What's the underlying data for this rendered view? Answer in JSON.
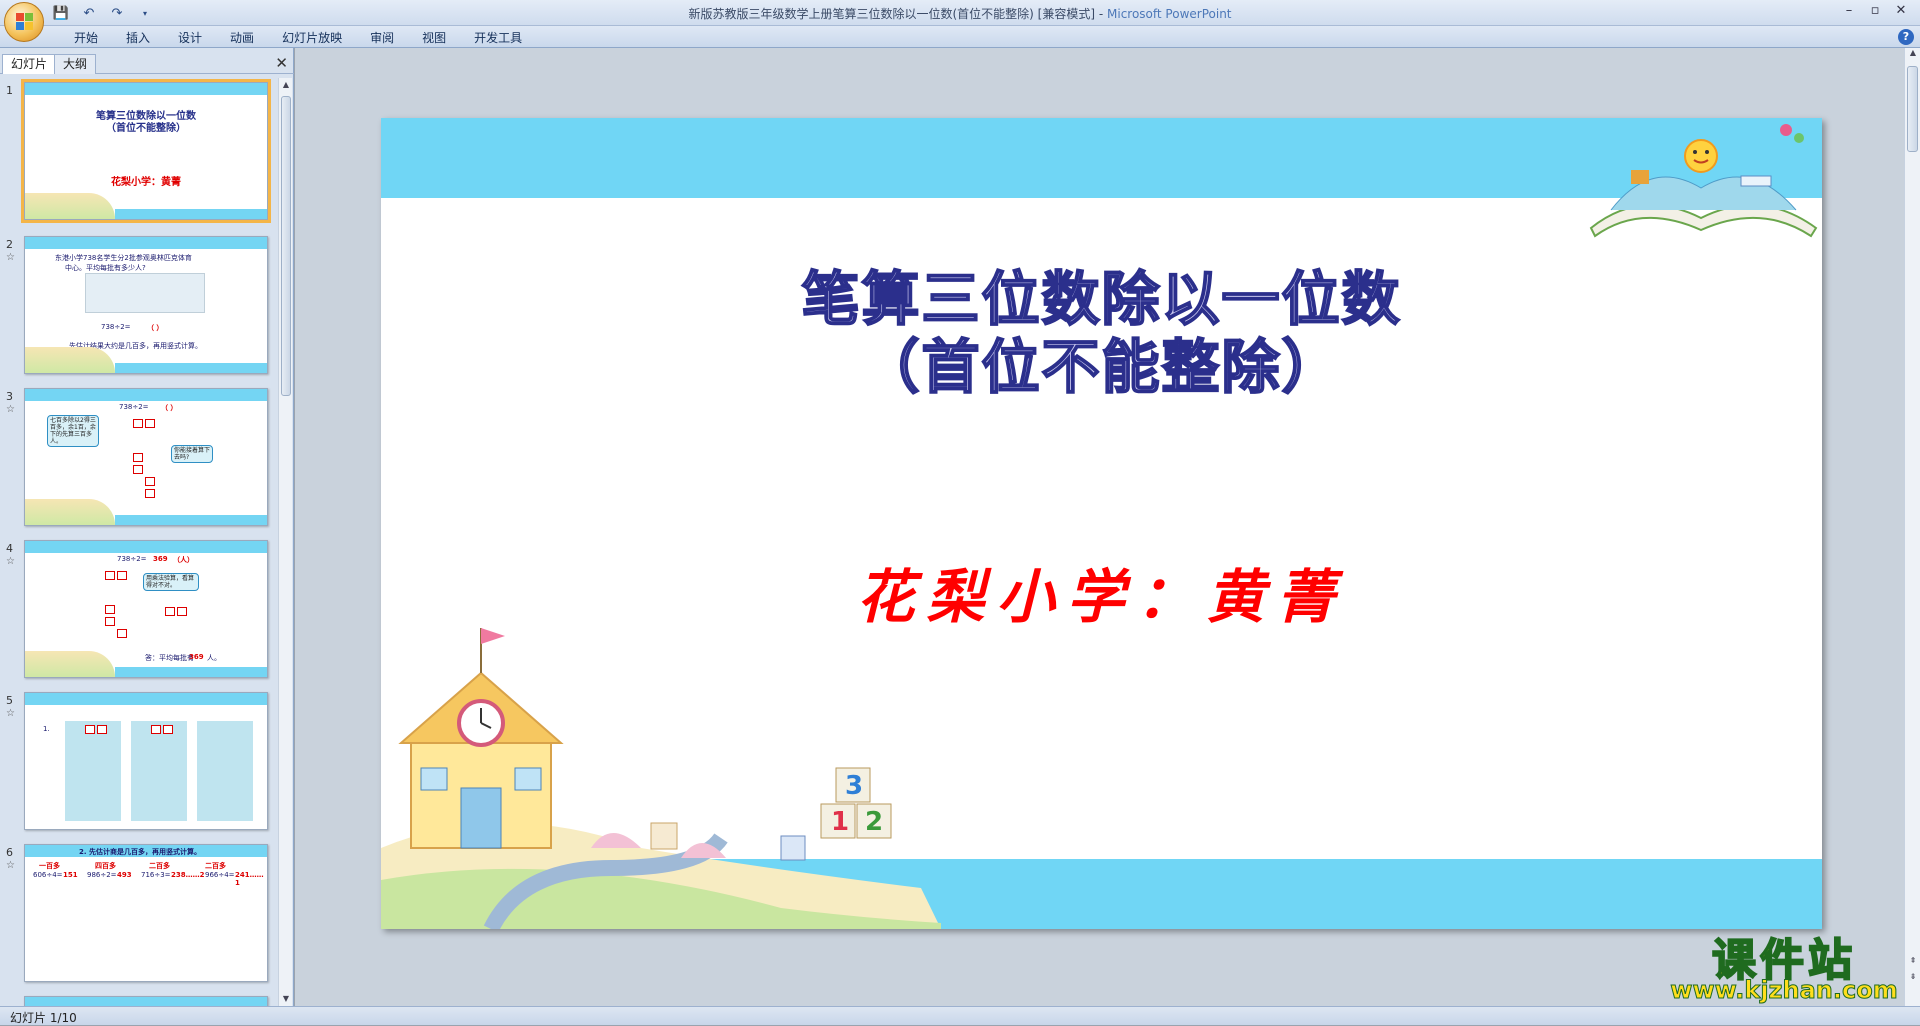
{
  "window": {
    "title": "新版苏教版三年级数学上册笔算三位数除以一位数(首位不能整除) [兼容模式] - ",
    "app_name": "Microsoft PowerPoint"
  },
  "ribbon": {
    "tabs": [
      "开始",
      "插入",
      "设计",
      "动画",
      "幻灯片放映",
      "审阅",
      "视图",
      "开发工具"
    ]
  },
  "pane": {
    "tabs": [
      "幻灯片",
      "大纲"
    ],
    "close": "✕"
  },
  "thumbnails": [
    {
      "num": "1",
      "title_line1": "笔算三位数除以一位数",
      "title_line2": "（首位不能整除）",
      "author": "花梨小学：黄菁"
    },
    {
      "num": "2",
      "text1": "东港小学738名学生分2批参观奥林匹克体育",
      "text2": "中心。平均每批有多少人?",
      "text3": "738÷2=",
      "text4": "（    ）",
      "text5": "先估计结果大约是几百多，再用竖式计算。"
    },
    {
      "num": "3",
      "text1": "738÷2=",
      "text2": "（    ）",
      "bubble1": "七百多除以2得三百多，余1百，余下的先算三百多人。",
      "bubble2": "你能接着算下去吗?"
    },
    {
      "num": "4",
      "text1": "738÷2=",
      "answer": "369",
      "unit": "（人）",
      "bubble": "用乘法验算，看算得对不对。",
      "answer_text": "答：平均每批有",
      "answer_val": "369",
      "answer_unit": "人。"
    },
    {
      "num": "5",
      "label": "1."
    },
    {
      "num": "6",
      "heading": "2. 先估计商是几百多，再用竖式计算。",
      "eq1": "606÷4=",
      "r1": "151",
      "eq2": "986÷2=",
      "r2": "493",
      "eq3": "716÷3=",
      "r3": "238……2",
      "eq4": "966÷4=",
      "r4": "241……1",
      "tag1": "一百多",
      "tag2": "四百多",
      "tag3": "二百多",
      "tag4": "二百多"
    }
  ],
  "slide": {
    "title_line1": "笔算三位数除以一位数",
    "title_line2": "（首位不能整除）",
    "author": "花梨小学：黄菁"
  },
  "status": {
    "slide_info": "幻灯片 1/10"
  },
  "watermark": {
    "text": "课件站",
    "url": "www.kjzhan.com"
  },
  "colors": {
    "band": "#70d6f5",
    "title_outline": "#2b2f8c",
    "author_red": "#ff0000",
    "selection": "#f4b548"
  }
}
